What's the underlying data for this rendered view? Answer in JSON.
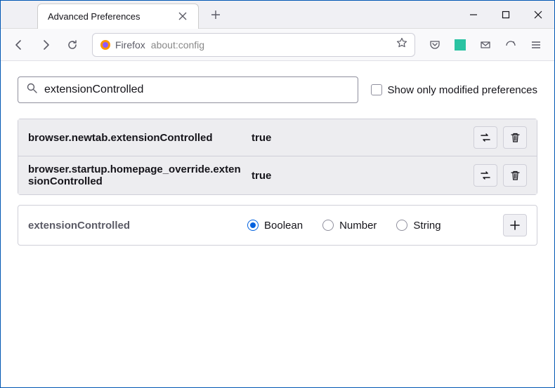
{
  "titlebar": {
    "tab_title": "Advanced Preferences"
  },
  "navbar": {
    "identity_label": "Firefox",
    "url": "about:config"
  },
  "search": {
    "value": "extensionControlled",
    "checkbox_label": "Show only modified preferences"
  },
  "prefs": [
    {
      "name": "browser.newtab.extensionControlled",
      "value": "true"
    },
    {
      "name": "browser.startup.homepage_override.extensionControlled",
      "value": "true"
    }
  ],
  "add_row": {
    "name": "extensionControlled",
    "types": {
      "boolean": "Boolean",
      "number": "Number",
      "string": "String"
    }
  }
}
